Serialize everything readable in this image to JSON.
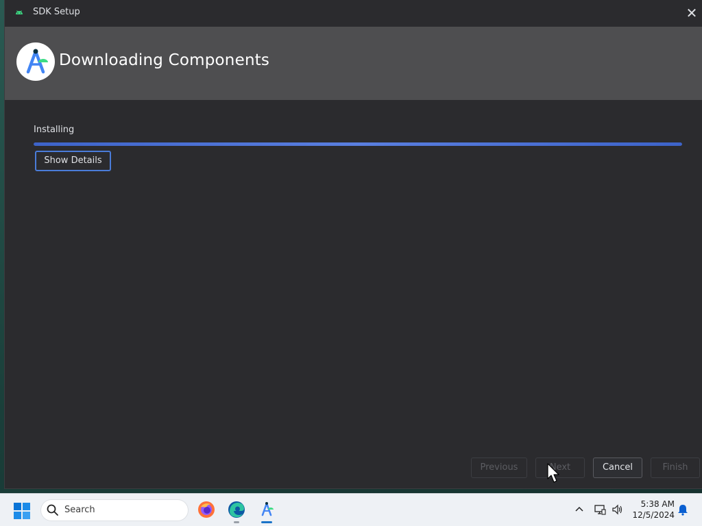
{
  "window": {
    "title": "SDK Setup",
    "close_glyph": "✕",
    "icon": "android-icon"
  },
  "header": {
    "title": "Downloading Components",
    "logo": "android-studio-logo"
  },
  "content": {
    "status_label": "Installing",
    "progress": 1.0,
    "show_details_label": "Show Details"
  },
  "buttons": {
    "previous": "Previous",
    "next": "Next",
    "cancel": "Cancel",
    "finish": "Finish"
  },
  "taskbar": {
    "search_placeholder": "Search",
    "apps": [
      "firefox-icon",
      "edge-icon",
      "android-studio-icon"
    ],
    "time": "5:38 AM",
    "date": "12/5/2024"
  },
  "colors": {
    "accent": "#4a7cd9",
    "header_bg": "#4e4e50",
    "window_bg": "#2b2b2e"
  }
}
